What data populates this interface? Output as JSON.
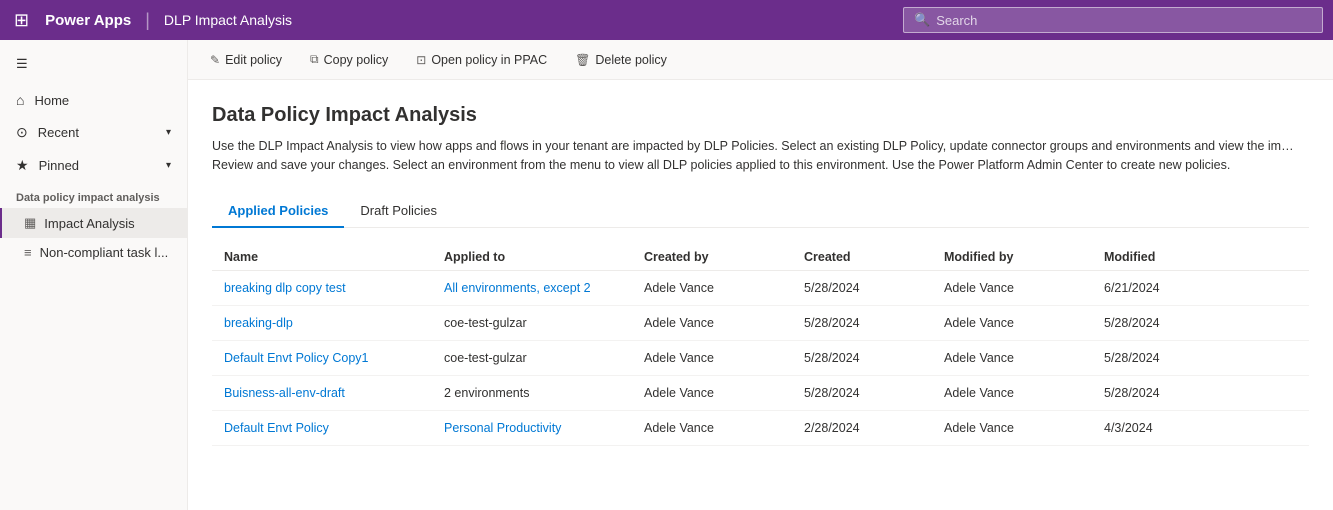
{
  "topNav": {
    "brandLabel": "Power Apps",
    "separator": "|",
    "pageTitle": "DLP Impact Analysis",
    "searchPlaceholder": "Search"
  },
  "sidebar": {
    "hamburgerIcon": "☰",
    "navItems": [
      {
        "id": "home",
        "icon": "⌂",
        "label": "Home"
      },
      {
        "id": "recent",
        "icon": "⊙",
        "label": "Recent",
        "hasChevron": true
      },
      {
        "id": "pinned",
        "icon": "★",
        "label": "Pinned",
        "hasChevron": true
      }
    ],
    "sectionLabel": "Data policy impact analysis",
    "subItems": [
      {
        "id": "impact-analysis",
        "icon": "▦",
        "label": "Impact Analysis",
        "active": true
      },
      {
        "id": "non-compliant",
        "icon": "≡",
        "label": "Non-compliant task l..."
      }
    ]
  },
  "toolbar": {
    "buttons": [
      {
        "id": "edit-policy",
        "icon": "✎",
        "label": "Edit policy"
      },
      {
        "id": "copy-policy",
        "icon": "⧉",
        "label": "Copy policy"
      },
      {
        "id": "open-ppac",
        "icon": "⊡",
        "label": "Open policy in PPAC"
      },
      {
        "id": "delete-policy",
        "icon": "🗑",
        "label": "Delete policy"
      }
    ]
  },
  "pageContent": {
    "title": "Data Policy Impact Analysis",
    "description": "Use the DLP Impact Analysis to view how apps and flows in your tenant are impacted by DLP Policies. Select an existing DLP Policy, update connector groups and environments and view the im… Review and save your changes. Select an environment from the menu to view all DLP policies applied to this environment. Use the Power Platform Admin Center to create new policies.",
    "tabs": [
      {
        "id": "applied",
        "label": "Applied Policies",
        "active": true
      },
      {
        "id": "draft",
        "label": "Draft Policies",
        "active": false
      }
    ],
    "tableHeaders": [
      "Name",
      "Applied to",
      "Created by",
      "Created",
      "Modified by",
      "Modified"
    ],
    "tableRows": [
      {
        "name": "breaking dlp copy test",
        "appliedTo": "All environments, except 2",
        "createdBy": "Adele Vance",
        "created": "5/28/2024",
        "modifiedBy": "Adele Vance",
        "modified": "6/21/2024",
        "nameIsLink": true,
        "appliedToIsLink": true
      },
      {
        "name": "breaking-dlp",
        "appliedTo": "coe-test-gulzar",
        "createdBy": "Adele Vance",
        "created": "5/28/2024",
        "modifiedBy": "Adele Vance",
        "modified": "5/28/2024",
        "nameIsLink": true,
        "appliedToIsLink": false
      },
      {
        "name": "Default Envt Policy Copy1",
        "appliedTo": "coe-test-gulzar",
        "createdBy": "Adele Vance",
        "created": "5/28/2024",
        "modifiedBy": "Adele Vance",
        "modified": "5/28/2024",
        "nameIsLink": true,
        "appliedToIsLink": false
      },
      {
        "name": "Buisness-all-env-draft",
        "appliedTo": "2 environments",
        "createdBy": "Adele Vance",
        "created": "5/28/2024",
        "modifiedBy": "Adele Vance",
        "modified": "5/28/2024",
        "nameIsLink": true,
        "appliedToIsLink": false
      },
      {
        "name": "Default Envt Policy",
        "appliedTo": "Personal Productivity",
        "createdBy": "Adele Vance",
        "created": "2/28/2024",
        "modifiedBy": "Adele Vance",
        "modified": "4/3/2024",
        "nameIsLink": true,
        "appliedToIsLink": true
      }
    ]
  }
}
